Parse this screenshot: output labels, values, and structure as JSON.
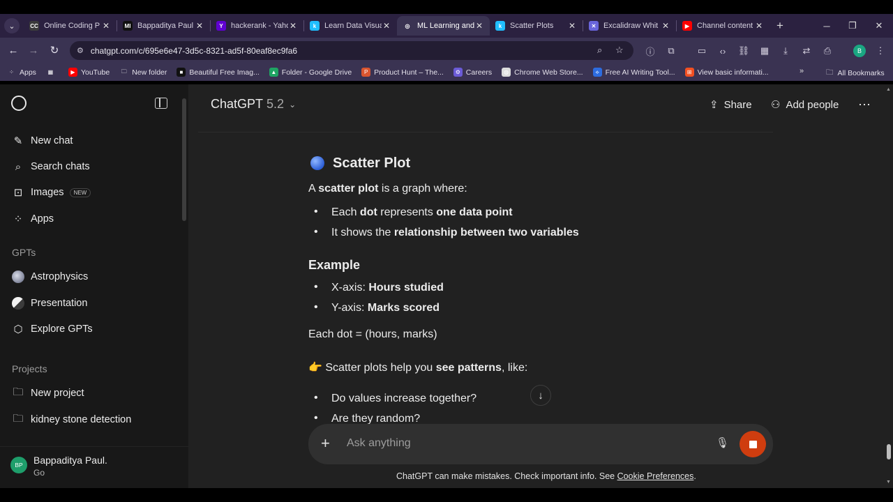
{
  "browser": {
    "tabs": [
      {
        "label": "Online Coding P",
        "icon": "codechef-icon",
        "color": "#3b3b3b",
        "glyph": "CC"
      },
      {
        "label": "Bappaditya Paul",
        "icon": "mathworks-icon",
        "color": "#111111",
        "glyph": "MI"
      },
      {
        "label": "hackerank - Yaho",
        "icon": "yahoo-icon",
        "color": "#6001d2",
        "glyph": "Y"
      },
      {
        "label": "Learn Data Visua",
        "icon": "kaggle-icon",
        "color": "#20beff",
        "glyph": "k"
      },
      {
        "label": "ML Learning and",
        "icon": "chatgpt-icon",
        "color": "#3a3352",
        "glyph": "◎"
      },
      {
        "label": "Scatter Plots",
        "icon": "kaggle-icon",
        "color": "#20beff",
        "glyph": "k"
      },
      {
        "label": "Excalidraw Whit",
        "icon": "excalidraw-icon",
        "color": "#6965db",
        "glyph": "✕"
      },
      {
        "label": "Channel content",
        "icon": "youtube-icon",
        "color": "#ff0000",
        "glyph": "▶"
      }
    ],
    "active_tab_index": 4,
    "url": "chatgpt.com/c/695e6e47-3d5c-8321-ad5f-80eaf8ec9fa6",
    "profile_initial": "B",
    "bookmarks": [
      {
        "label": "Apps",
        "icon": "apps-grid-icon"
      },
      {
        "label": "",
        "icon": "grid-icon"
      },
      {
        "label": "YouTube",
        "icon": "youtube-icon"
      },
      {
        "label": "New folder",
        "icon": "folder-icon"
      },
      {
        "label": "Beautiful Free Imag...",
        "icon": "unsplash-icon"
      },
      {
        "label": "Folder - Google Drive",
        "icon": "google-drive-icon"
      },
      {
        "label": "Product Hunt – The...",
        "icon": "product-hunt-icon"
      },
      {
        "label": "Careers",
        "icon": "careers-icon"
      },
      {
        "label": "Chrome Web Store...",
        "icon": "chrome-web-store-icon"
      },
      {
        "label": "Free AI Writing Tool...",
        "icon": "ai-writing-icon"
      },
      {
        "label": "View basic informati...",
        "icon": "windows-icon"
      }
    ],
    "all_bookmarks": "All Bookmarks"
  },
  "sidebar": {
    "items": [
      {
        "label": "New chat",
        "icon": "compose-icon"
      },
      {
        "label": "Search chats",
        "icon": "search-icon"
      },
      {
        "label": "Images",
        "icon": "images-icon",
        "badge": "NEW"
      },
      {
        "label": "Apps",
        "icon": "apps-icon"
      }
    ],
    "gpts_title": "GPTs",
    "gpts": [
      {
        "label": "Astrophysics",
        "icon": "astrophysics-icon"
      },
      {
        "label": "Presentation",
        "icon": "presentation-icon"
      },
      {
        "label": "Explore GPTs",
        "icon": "explore-icon"
      }
    ],
    "projects_title": "Projects",
    "projects": [
      {
        "label": "New project",
        "icon": "new-folder-icon"
      },
      {
        "label": "kidney stone detection",
        "icon": "folder-icon"
      }
    ],
    "user": {
      "initials": "BP",
      "name": "Bappaditya Paul.",
      "plan": "Go"
    }
  },
  "header": {
    "model": "ChatGPT",
    "version": "5.2",
    "share": "Share",
    "add_people": "Add people"
  },
  "message": {
    "heading": "Scatter Plot",
    "intro_pre": "A ",
    "intro_bold": "scatter plot",
    "intro_post": " is a graph where:",
    "b1_pre": "Each ",
    "b1_bold1": "dot",
    "b1_mid": " represents ",
    "b1_bold2": "one data point",
    "b2_pre": "It shows the ",
    "b2_bold": "relationship between two variables",
    "example_heading": "Example",
    "ex1_pre": "X-axis: ",
    "ex1_bold": "Hours studied",
    "ex2_pre": "Y-axis: ",
    "ex2_bold": "Marks scored",
    "each_dot": "Each dot = (hours, marks)",
    "pattern_emoji": "👉",
    "pattern_pre": " Scatter plots help you ",
    "pattern_bold": "see patterns",
    "pattern_post": ", like:",
    "q1": "Do values increase together?",
    "q2": "Are they random?"
  },
  "composer": {
    "placeholder": "Ask anything"
  },
  "footer": {
    "disclaimer": "ChatGPT can make mistakes. Check important info. See ",
    "link": "Cookie Preferences",
    "end": "."
  }
}
